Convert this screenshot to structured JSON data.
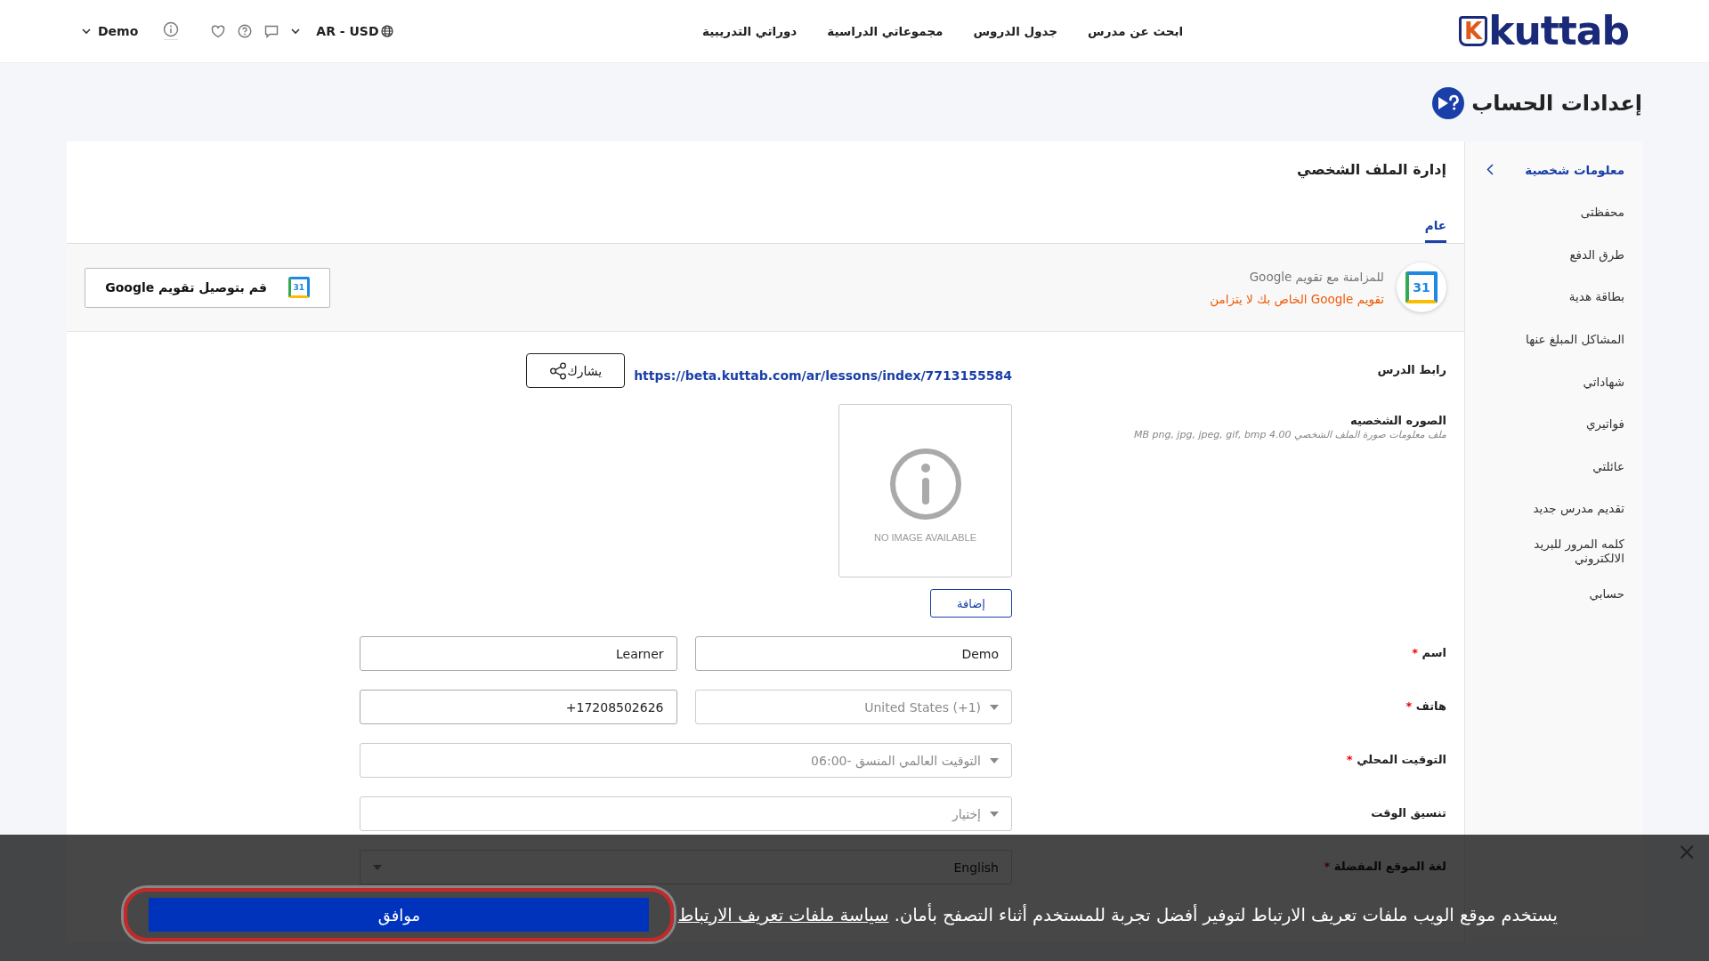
{
  "header": {
    "logo": {
      "mark": "K",
      "text": "kuttab"
    },
    "nav": [
      {
        "label": "ابحث عن مدرس"
      },
      {
        "label": "جدول الدروس"
      },
      {
        "label": "مجموعاتي الدراسية"
      },
      {
        "label": "دوراتي التدريبية"
      }
    ],
    "locale": "AR - USD",
    "user": "Demo"
  },
  "page_title": "إعدادات الحساب",
  "sidebar": {
    "items": [
      {
        "label": "معلومات شخصية",
        "selected": true
      },
      {
        "label": "محفظتى",
        "selected": false
      },
      {
        "label": "طرق الدفع",
        "selected": false
      },
      {
        "label": "بطاقة هدية",
        "selected": false
      },
      {
        "label": "المشاكل المبلغ عنها",
        "selected": false
      },
      {
        "label": "شهاداتي",
        "selected": false
      },
      {
        "label": "فواتيري",
        "selected": false
      },
      {
        "label": "عائلتي",
        "selected": false
      },
      {
        "label": "تقديم مدرس جديد",
        "selected": false
      },
      {
        "label": "كلمه المرور للبريد الالكتروني",
        "selected": false
      },
      {
        "label": "حسابي",
        "selected": false
      }
    ]
  },
  "card": {
    "title": "إدارة الملف الشخصي",
    "tabs": [
      {
        "label": "عام",
        "selected": true
      }
    ],
    "google_sync": {
      "icon_day": "31",
      "title": "للمزامنة مع تقويم Google",
      "status": "تقويم Google الخاص بك لا يتزامن",
      "button": {
        "label": "قم بتوصيل تقويم Google",
        "icon_day": "31"
      }
    },
    "lesson_link": {
      "label": "رابط الدرس",
      "url": "https://beta.kuttab.com/ar/lessons/index/7713155584",
      "share": "يشارك"
    },
    "photo": {
      "label": "الصوره الشخصيه",
      "hint": "ملف معلومات صورة الملف الشخصي MB png, jpg, jpeg, gif, bmp 4.00",
      "no_image": "NO IMAGE AVAILABLE",
      "add": "إضافة"
    },
    "fields": [
      {
        "label": "اسم",
        "required_mark": "*",
        "controls": [
          {
            "kind": "text",
            "value": "Demo"
          },
          {
            "kind": "text",
            "value": "Learner"
          }
        ]
      },
      {
        "label": "هاتف",
        "required_mark": "*",
        "controls": [
          {
            "kind": "dropdown",
            "value": "United States (+1)",
            "muted": true
          },
          {
            "kind": "text",
            "value": "+17208502626"
          }
        ]
      },
      {
        "label": "التوقيت المحلي",
        "required_mark": "*",
        "controls": [
          {
            "kind": "dropdown",
            "value": "التوقيت العالمي المنسق -06:00",
            "muted": true
          }
        ]
      },
      {
        "label": "تنسيق الوقت",
        "controls": [
          {
            "kind": "dropdown",
            "placeholder": "إختيار"
          }
        ]
      },
      {
        "label": "لغة الموقع المفضلة",
        "required_mark": "*",
        "controls": [
          {
            "kind": "select",
            "value": "English",
            "muted": false
          }
        ]
      }
    ]
  },
  "cookie_bar": {
    "text": "يستخدم موقع الويب ملفات تعريف الارتباط لتوفير أفضل تجربة للمستخدم أثناء التصفح بأمان.",
    "link": "سياسة ملفات تعريف الارتباط",
    "button": "موافق",
    "close": "×"
  }
}
